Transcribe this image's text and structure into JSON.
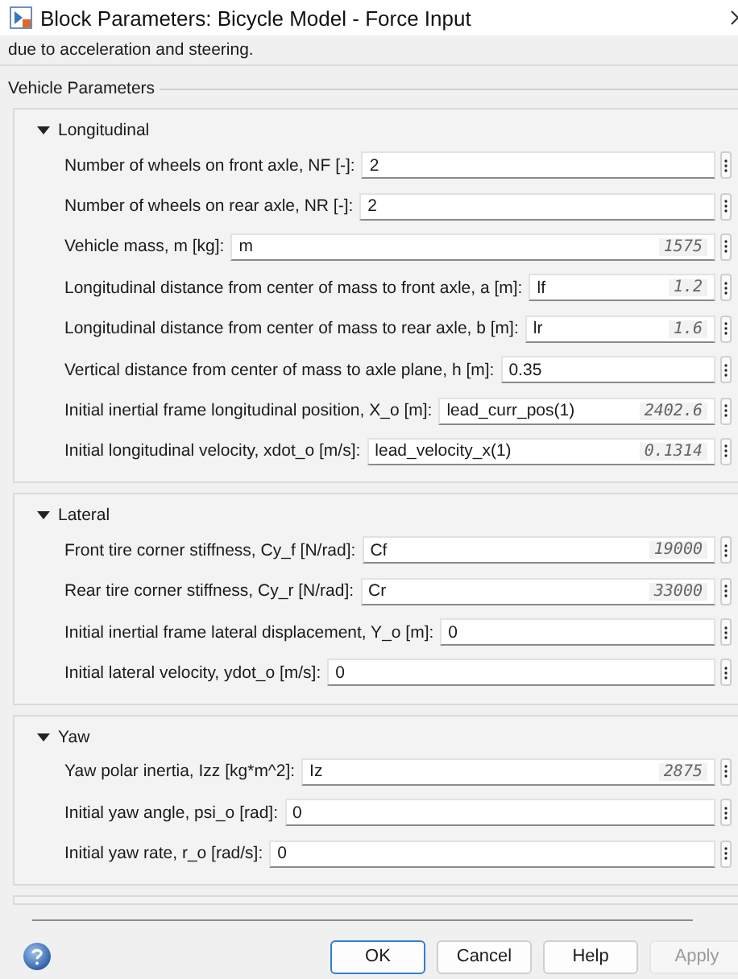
{
  "window": {
    "title": "Block Parameters: Bicycle Model - Force Input"
  },
  "description": "due to acceleration and steering.",
  "group": {
    "title": "Vehicle Parameters"
  },
  "sections": [
    {
      "title": "Longitudinal",
      "expanded": true,
      "params": [
        {
          "label": "Number of wheels on front axle, NF [-]:",
          "value": "2"
        },
        {
          "label": "Number of wheels on rear axle, NR [-]:",
          "value": "2"
        },
        {
          "label": "Vehicle mass, m [kg]:",
          "value": "m",
          "evaluated": "1575"
        },
        {
          "label": "Longitudinal distance from center of mass to front axle, a [m]:",
          "value": "lf",
          "evaluated": "1.2"
        },
        {
          "label": "Longitudinal distance from center of mass to rear axle, b [m]:",
          "value": "lr",
          "evaluated": "1.6"
        },
        {
          "label": "Vertical distance from center of mass to axle plane, h [m]:",
          "value": "0.35"
        },
        {
          "label": "Initial inertial frame longitudinal position, X_o [m]:",
          "value": "lead_curr_pos(1)",
          "evaluated": "2402.6"
        },
        {
          "label": "Initial longitudinal velocity, xdot_o [m/s]:",
          "value": "lead_velocity_x(1)",
          "evaluated": "0.1314"
        }
      ]
    },
    {
      "title": "Lateral",
      "expanded": true,
      "params": [
        {
          "label": "Front tire corner stiffness, Cy_f [N/rad]:",
          "value": "Cf",
          "evaluated": "19000"
        },
        {
          "label": "Rear tire corner stiffness, Cy_r [N/rad]:",
          "value": "Cr",
          "evaluated": "33000"
        },
        {
          "label": "Initial inertial frame lateral displacement, Y_o [m]:",
          "value": "0"
        },
        {
          "label": "Initial lateral velocity, ydot_o [m/s]:",
          "value": "0"
        }
      ]
    },
    {
      "title": "Yaw",
      "expanded": true,
      "params": [
        {
          "label": "Yaw polar inertia, Izz [kg*m^2]:",
          "value": "Iz",
          "evaluated": "2875"
        },
        {
          "label": "Initial yaw angle, psi_o [rad]:",
          "value": "0"
        },
        {
          "label": "Initial yaw rate, r_o [rad/s]:",
          "value": "0"
        }
      ]
    }
  ],
  "buttons": [
    {
      "label": "OK",
      "default": true,
      "disabled": false
    },
    {
      "label": "Cancel",
      "default": false,
      "disabled": false
    },
    {
      "label": "Help",
      "default": false,
      "disabled": false
    },
    {
      "label": "Apply",
      "default": false,
      "disabled": true
    }
  ]
}
